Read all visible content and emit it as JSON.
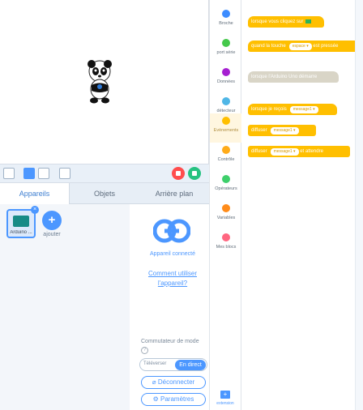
{
  "stage": {
    "character": "panda"
  },
  "toolbar": {
    "buttons": [
      "fullscreen-icon",
      "small-stage-icon",
      "large-stage-icon",
      "grid-icon"
    ],
    "stop_color": "#ff4d4d",
    "go_color": "#26c281"
  },
  "tabs": [
    {
      "label": "Appareils",
      "active": true
    },
    {
      "label": "Objets",
      "active": false
    },
    {
      "label": "Arrière plan",
      "active": false
    }
  ],
  "devices": {
    "card_label": "Arduino ...",
    "add_label": "ajouter"
  },
  "device_info": {
    "connected_label": "Appareil connecté",
    "help_link": "Comment utiliser l'appareil?",
    "mode_label": "Commutateur de mode",
    "upload_label": "Téléverser",
    "live_label": "En direct",
    "disconnect_label": "Déconnecter",
    "settings_label": "Paramètres"
  },
  "categories": [
    {
      "label": "Broche",
      "color": "#3c8cff"
    },
    {
      "label": "port série",
      "color": "#44c84a"
    },
    {
      "label": "Données",
      "color": "#a61fd1"
    },
    {
      "label": "détecteur",
      "color": "#4fb6e6"
    },
    {
      "label": "Evènements",
      "color": "#ffbf00",
      "active": true
    },
    {
      "label": "Contrôle",
      "color": "#ffab19"
    },
    {
      "label": "Opérateurs",
      "color": "#3ecf6b"
    },
    {
      "label": "Variables",
      "color": "#ff8c1a"
    },
    {
      "label": "Mes blocs",
      "color": "#ff6680"
    }
  ],
  "extension": {
    "label": "extension"
  },
  "blocks": {
    "when_clicked": "lorsque vous cliquez sur",
    "when_key": "quand la touche",
    "key_value": "espace ▾",
    "key_suffix": "est pressée",
    "when_arduino": "lorsque l'Arduino Uno démarre",
    "when_receive": "lorsque je reçois",
    "message1": "message1 ▾",
    "broadcast": "diffuser",
    "broadcast_wait": "diffuser",
    "and_wait": "et attendre"
  }
}
